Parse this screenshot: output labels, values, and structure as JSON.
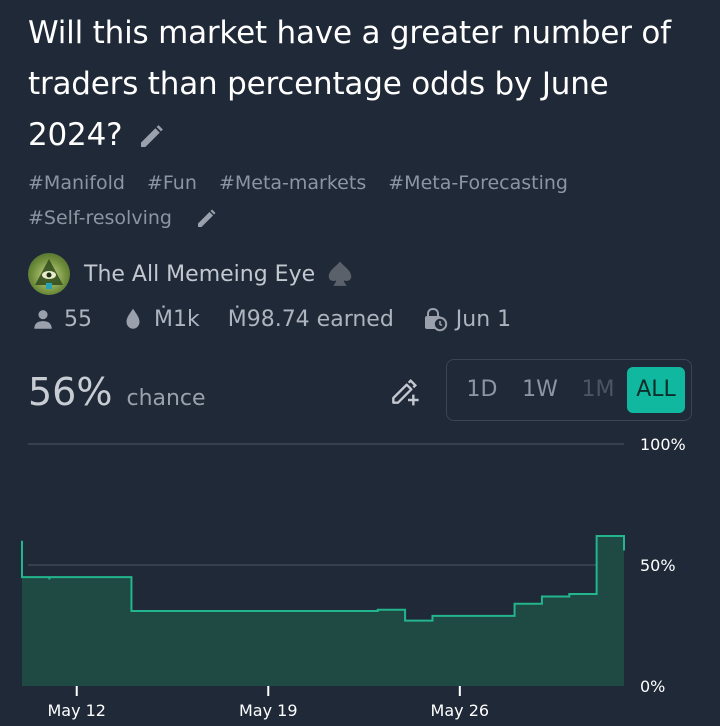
{
  "market": {
    "title": "Will this market have a greater number of traders than percentage odds by June 2024?",
    "tags": [
      "#Manifold",
      "#Fun",
      "#Meta-markets",
      "#Meta-Forecasting",
      "#Self-resolving"
    ]
  },
  "creator": {
    "name": "The All Memeing Eye"
  },
  "stats": {
    "traders": "55",
    "volume": "Ṁ1k",
    "earned": "Ṁ98.74 earned",
    "close_date": "Jun 1"
  },
  "probability": {
    "value": "56%",
    "label": "chance"
  },
  "time_range": {
    "options": [
      "1D",
      "1W",
      "1M",
      "ALL"
    ],
    "selected": "ALL",
    "disabled": [
      "1M"
    ]
  },
  "colors": {
    "background": "#1f2937",
    "accent": "#11b8a0",
    "chart_line": "#23b58d",
    "chart_fill": "#1f4a43"
  },
  "icons": {
    "title_edit": "pencil-icon",
    "tags_edit": "pencil-icon",
    "spade": "spade-icon",
    "traders": "user-icon",
    "volume": "droplet-icon",
    "close": "lock-clock-icon",
    "edit_probability": "pencil-plus-icon"
  },
  "chart_data": {
    "type": "area",
    "title": "",
    "xlabel": "",
    "ylabel": "",
    "ylim": [
      0,
      100
    ],
    "y_ticks": [
      "100%",
      "50%",
      "0%"
    ],
    "x_ticks": [
      "May 12",
      "May 19",
      "May 26"
    ],
    "grid": "horizontal",
    "series": [
      {
        "values_note": "",
        "x": [
          "May 10",
          "May 10",
          "May 10",
          "May 11",
          "May 11",
          "May 11",
          "May 14",
          "May 14",
          "May 20",
          "May 23",
          "May 24",
          "May 24",
          "May 25",
          "May 25",
          "May 27",
          "May 28",
          "May 28",
          "May 29",
          "May 29",
          "May 30",
          "May 30",
          "May 31",
          "May 31",
          "May 31",
          "Jun 1"
        ],
        "y": [
          55,
          60,
          45,
          45,
          44,
          45,
          45,
          31,
          31,
          31.5,
          30,
          27,
          29,
          29,
          29,
          30,
          34,
          36,
          37,
          38,
          38,
          39,
          58,
          62,
          56
        ]
      }
    ]
  }
}
